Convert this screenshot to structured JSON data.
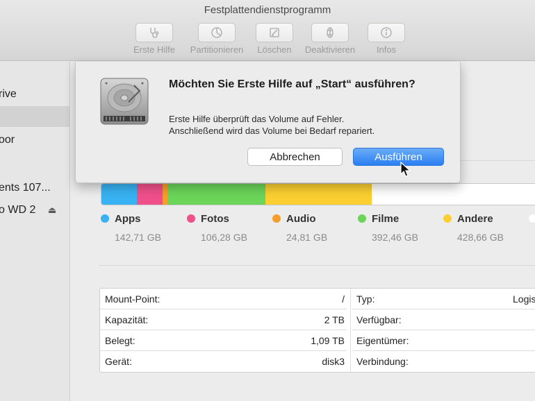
{
  "window": {
    "title": "Festplattendienstprogramm"
  },
  "toolbar": {
    "tools": [
      {
        "label": "Erste Hilfe",
        "icon": "stethoscope-icon"
      },
      {
        "label": "Partitionieren",
        "icon": "partition-icon"
      },
      {
        "label": "Löschen",
        "icon": "erase-icon"
      },
      {
        "label": "Deaktivieren",
        "icon": "unmount-icon"
      },
      {
        "label": "Infos",
        "icon": "info-icon"
      }
    ]
  },
  "sidebar": {
    "items": [
      {
        "label": "rive"
      },
      {
        "label": ""
      },
      {
        "label": "oor"
      },
      {
        "label": "ents 107..."
      },
      {
        "label": "o WD 2"
      }
    ]
  },
  "dialog": {
    "title": "Möchten Sie Erste Hilfe auf „Start“ ausführen?",
    "message_line1": "Erste Hilfe überprüft das Volume auf Fehler.",
    "message_line2": "Anschließend wird das Volume bei Bedarf repariert.",
    "cancel_label": "Abbrechen",
    "run_label": "Ausführen"
  },
  "usage": {
    "categories": [
      {
        "name": "Apps",
        "size": "142,71 GB",
        "color": "#38b2f2"
      },
      {
        "name": "Fotos",
        "size": "106,28 GB",
        "color": "#f0508a"
      },
      {
        "name": "Audio",
        "size": "24,81 GB",
        "color": "#f59e2d"
      },
      {
        "name": "Filme",
        "size": "392,46 GB",
        "color": "#6bd559"
      },
      {
        "name": "Andere",
        "size": "428,66 GB",
        "color": "#fbcf31"
      }
    ]
  },
  "info": {
    "left": [
      {
        "label": "Mount-Point:",
        "value": "/"
      },
      {
        "label": "Kapazität:",
        "value": "2 TB"
      },
      {
        "label": "Belegt:",
        "value": "1,09 TB"
      },
      {
        "label": "Gerät:",
        "value": "disk3"
      }
    ],
    "right": [
      {
        "label": "Typ:",
        "value": "Logis"
      },
      {
        "label": "Verfügbar:",
        "value": ""
      },
      {
        "label": "Eigentümer:",
        "value": ""
      },
      {
        "label": "Verbindung:",
        "value": ""
      }
    ]
  }
}
